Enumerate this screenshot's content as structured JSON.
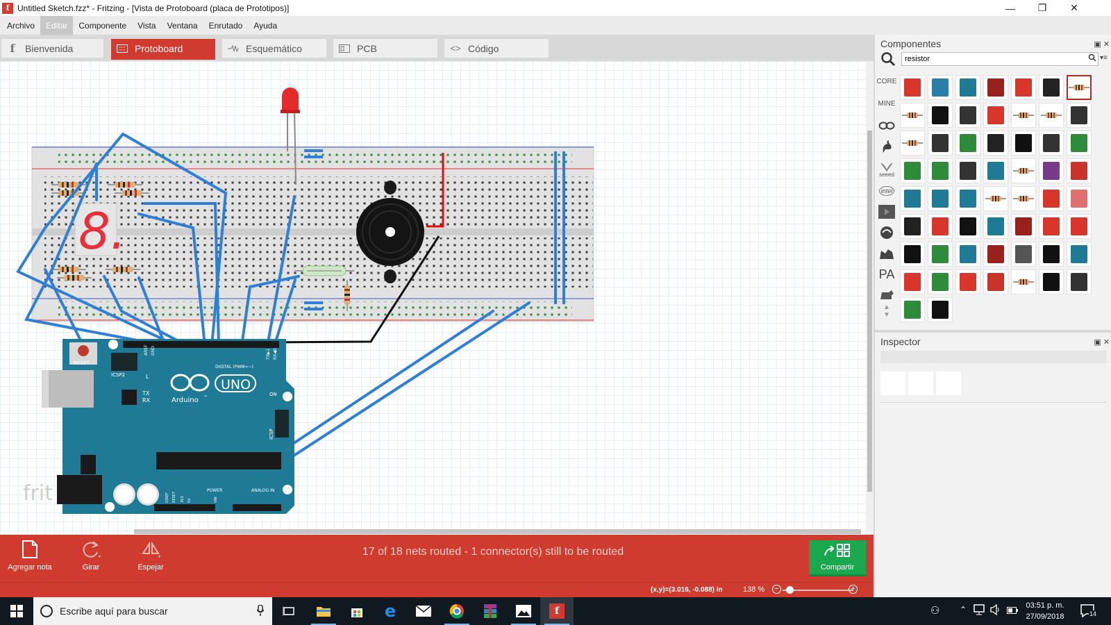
{
  "window": {
    "title": "Untitled Sketch.fzz* - Fritzing - [Vista de Protoboard (placa de Prototipos)]",
    "app_icon_letter": "f"
  },
  "menu": [
    "Archivo",
    "Editar",
    "Componente",
    "Vista",
    "Ventana",
    "Enrutado",
    "Ayuda"
  ],
  "menu_active": "Editar",
  "tabs": [
    {
      "label": "Bienvenida",
      "icon": "fritzing-icon"
    },
    {
      "label": "Protoboard",
      "icon": "breadboard-icon",
      "active": true
    },
    {
      "label": "Esquemático",
      "icon": "schematic-icon"
    },
    {
      "label": "PCB",
      "icon": "pcb-icon"
    },
    {
      "label": "Código",
      "icon": "code-icon"
    }
  ],
  "canvas": {
    "watermark": "frit",
    "arduino": {
      "reset": "RESET",
      "icsp2": "ICSP2",
      "icsp": "ICSP",
      "uno": "UNO",
      "brand": "Arduino",
      "tm": "™",
      "digital": "DIGITAL (PWM=~)",
      "power": "POWER",
      "analog": "ANALOG IN",
      "on": "ON",
      "l": "L",
      "tx": "TX",
      "rx": "RX",
      "aref": "AREF",
      "gnd": "GND",
      "ioref": "IOREF",
      "ioref_reset": "RESET",
      "v33": "3V3",
      "v5": "5V",
      "vin": "VIN",
      "txd": "TX▶1",
      "rxd": "RX◀0"
    },
    "seven_segment_digit": "8."
  },
  "toolbar": {
    "add_note": "Agregar nota",
    "rotate": "Girar",
    "mirror": "Espejar",
    "routing_status": "17 of 18 nets routed - 1 connector(s) still to be routed",
    "share": "Compartir"
  },
  "status": {
    "coords": "(x,y)=(3.016, -0.088) in",
    "zoom": "138 %",
    "zoom_level": 0.1
  },
  "components_panel": {
    "title": "Componentes",
    "search_value": "resistor",
    "bins": [
      "CORE",
      "MINE",
      "arduino-bin",
      "sparkfun-bin",
      "seeed",
      "intel",
      "snootlab-bin",
      "fab-bin",
      "adafruit-bin",
      "PA",
      "animal-bin"
    ]
  },
  "inspector": {
    "title": "Inspector"
  },
  "taskbar": {
    "search_placeholder": "Escribe aquí para buscar",
    "time": "03:51 p. m.",
    "date": "27/09/2018",
    "notification_count": "14",
    "apps": [
      "task-view",
      "file-explorer",
      "store",
      "edge",
      "mail",
      "chrome",
      "winrar",
      "photos",
      "fritzing"
    ]
  },
  "colors": {
    "accent": "#cf3b2f",
    "share": "#1aa84f",
    "wire": "#2f7fd6",
    "arduino": "#1f7a96"
  }
}
